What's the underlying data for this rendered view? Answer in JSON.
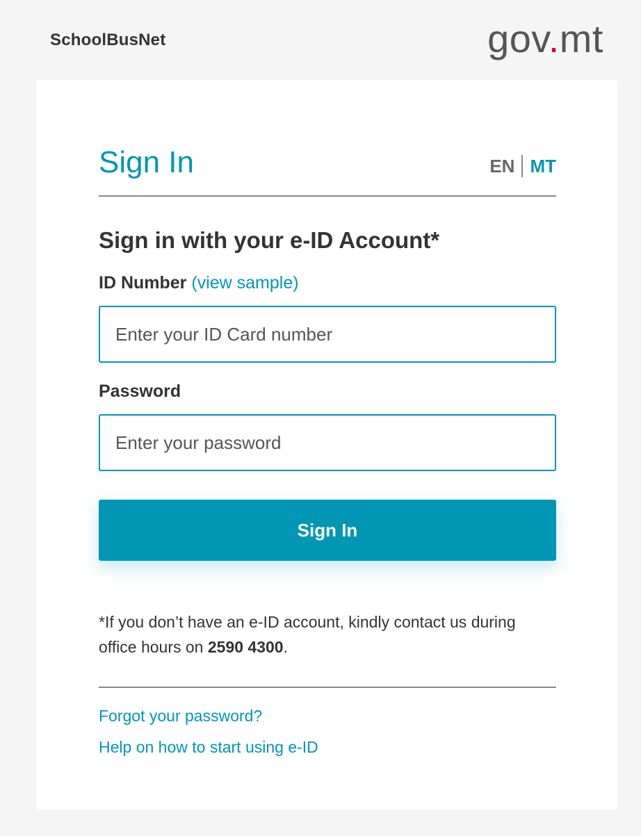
{
  "header": {
    "brand": "SchoolBusNet",
    "gov_text_a": "gov",
    "gov_text_dot": ".",
    "gov_text_b": "mt",
    "gov_dot_color": "#c8102e"
  },
  "form": {
    "title": "Sign In",
    "lang_en": "EN",
    "lang_mt": "MT",
    "subtitle": "Sign in with your e-ID Account*",
    "id_label": "ID Number",
    "id_link_open": "(",
    "id_link": "view sample",
    "id_link_close": ")",
    "id_placeholder": "Enter your ID Card number",
    "password_label": "Password",
    "password_placeholder": "Enter your password",
    "submit_label": "Sign In",
    "note_text": "*If you don’t have an e-ID account, kindly contact us during office hours on ",
    "note_phone": "2590 4300",
    "note_end": ".",
    "forgot_link": "Forgot your password?",
    "help_link": "Help on how to start using e-ID"
  },
  "colors": {
    "accent": "#0096b4",
    "background": "#f5f5f5",
    "card": "#ffffff"
  }
}
